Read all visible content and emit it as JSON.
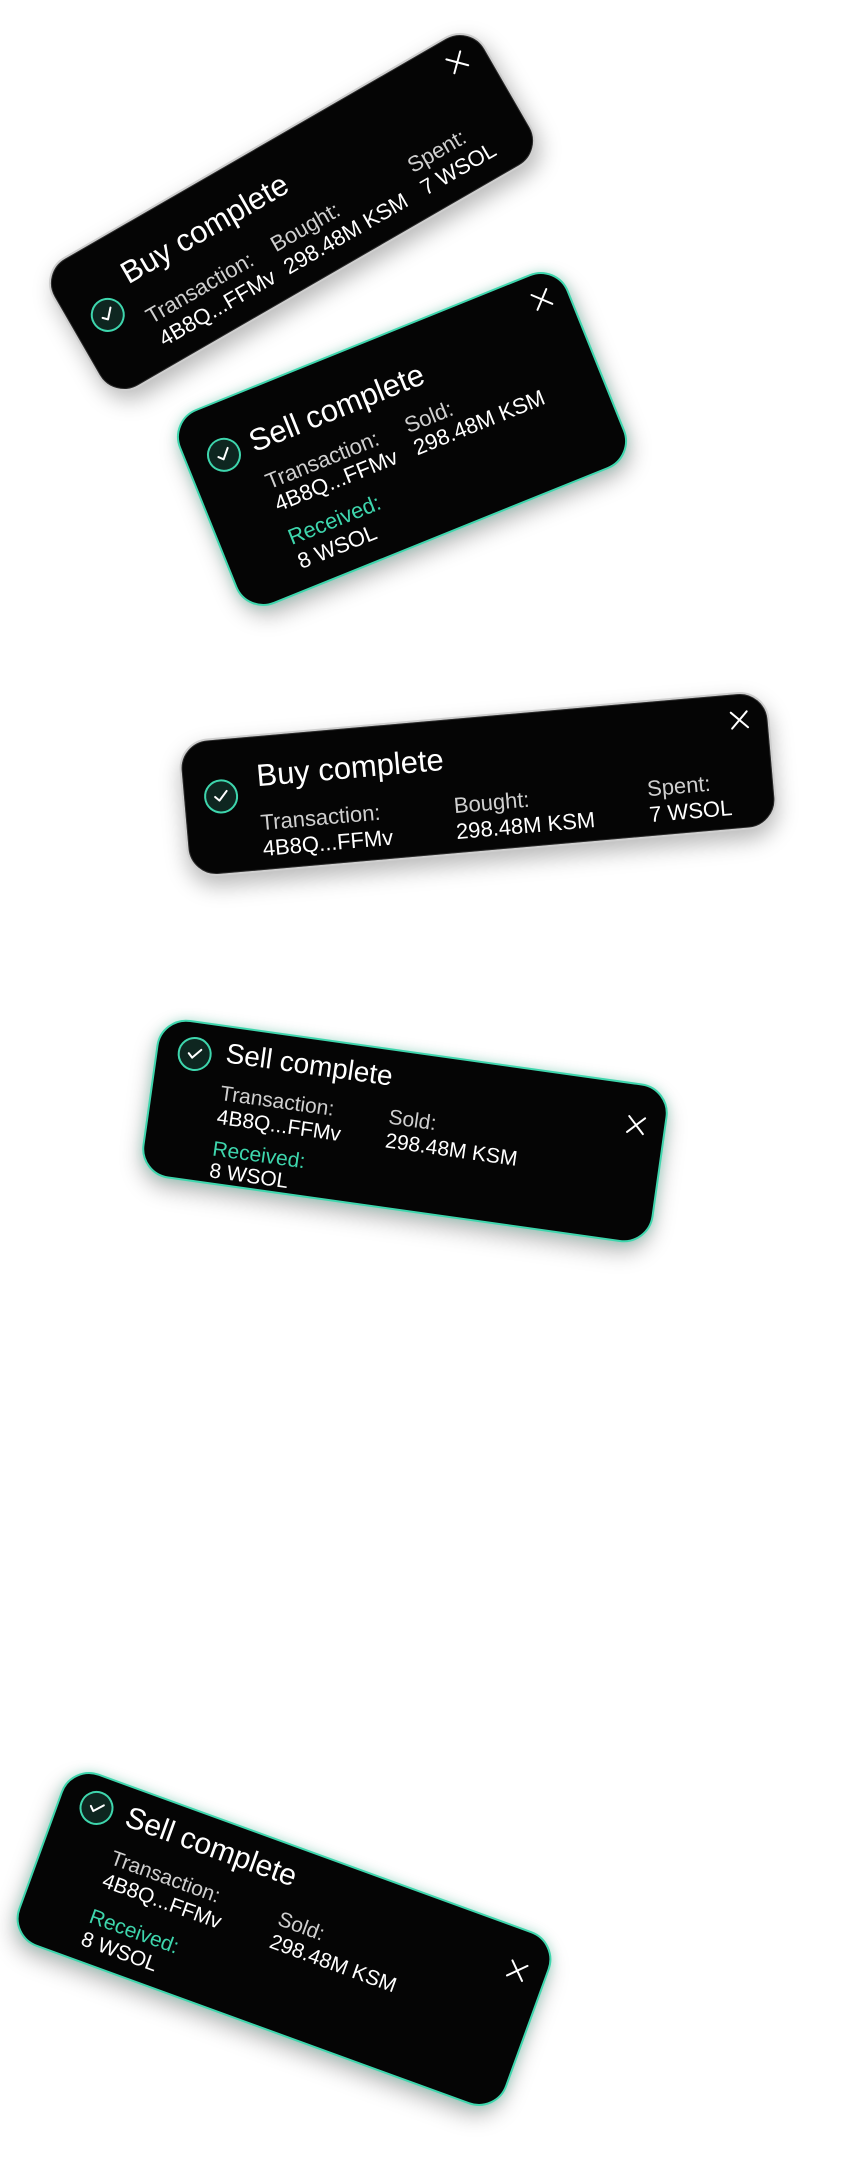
{
  "accent_color": "#3ed6ad",
  "toasts": [
    {
      "type": "buy",
      "title": "Buy complete",
      "transaction_label": "Transaction:",
      "transaction_value": "4B8Q...FFMv",
      "bought_label": "Bought:",
      "bought_value": "298.48M KSM",
      "spent_label": "Spent:",
      "spent_value": "7 WSOL",
      "icon": "check-circle-icon",
      "close_icon": "close-icon"
    },
    {
      "type": "sell",
      "title": "Sell complete",
      "transaction_label": "Transaction:",
      "transaction_value": "4B8Q...FFMv",
      "sold_label": "Sold:",
      "sold_value": "298.48M KSM",
      "received_label": "Received:",
      "received_value": "8 WSOL",
      "icon": "check-circle-icon",
      "close_icon": "close-icon"
    },
    {
      "type": "buy",
      "title": "Buy complete",
      "transaction_label": "Transaction:",
      "transaction_value": "4B8Q...FFMv",
      "bought_label": "Bought:",
      "bought_value": "298.48M KSM",
      "spent_label": "Spent:",
      "spent_value": "7 WSOL",
      "icon": "check-circle-icon",
      "close_icon": "close-icon"
    },
    {
      "type": "sell",
      "title": "Sell complete",
      "transaction_label": "Transaction:",
      "transaction_value": "4B8Q...FFMv",
      "sold_label": "Sold:",
      "sold_value": "298.48M KSM",
      "received_label": "Received:",
      "received_value": "8 WSOL",
      "icon": "check-circle-icon",
      "close_icon": "close-icon"
    },
    {
      "type": "sell",
      "title": "Sell complete",
      "transaction_label": "Transaction:",
      "transaction_value": "4B8Q...FFMv",
      "sold_label": "Sold:",
      "sold_value": "298.48M KSM",
      "received_label": "Received:",
      "received_value": "8 WSOL",
      "icon": "check-circle-icon",
      "close_icon": "close-icon"
    }
  ]
}
